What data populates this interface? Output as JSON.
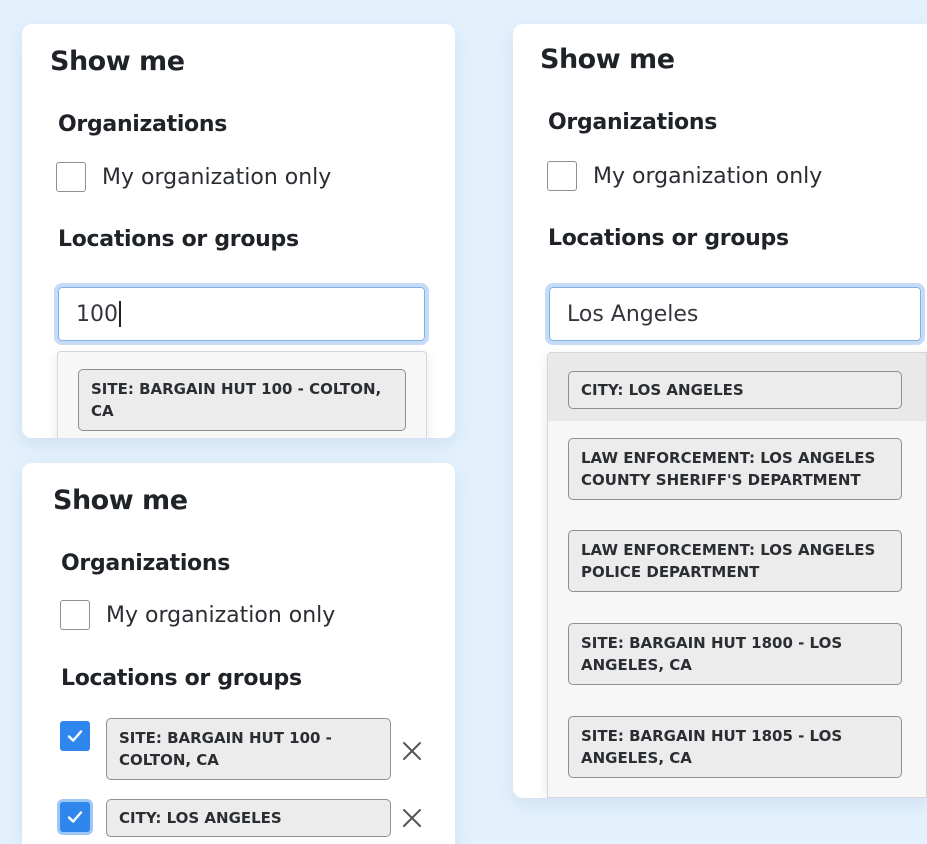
{
  "panels": {
    "p1": {
      "title": "Show me",
      "organizations_heading": "Organizations",
      "my_org_label": "My organization only",
      "locations_heading": "Locations or groups",
      "search_value": "100",
      "results": [
        "SITE: BARGAIN HUT 100 - COLTON, CA"
      ]
    },
    "p2": {
      "title": "Show me",
      "organizations_heading": "Organizations",
      "my_org_label": "My organization only",
      "locations_heading": "Locations or groups",
      "search_value": "Los Angeles",
      "results": [
        "CITY: LOS ANGELES",
        "LAW ENFORCEMENT: LOS ANGELES COUNTY SHERIFF'S DEPARTMENT",
        "LAW ENFORCEMENT: LOS ANGELES POLICE DEPARTMENT",
        "SITE: BARGAIN HUT 1800 - LOS ANGELES, CA",
        "SITE: BARGAIN HUT 1805 - LOS ANGELES, CA"
      ]
    },
    "p3": {
      "title": "Show me",
      "organizations_heading": "Organizations",
      "my_org_label": "My organization only",
      "locations_heading": "Locations or groups",
      "selected": [
        "SITE: BARGAIN HUT 100 - COLTON, CA",
        "CITY: LOS ANGELES"
      ]
    }
  },
  "icons": {
    "checkbox_checked": "checkmark-icon",
    "remove": "close-icon"
  },
  "colors": {
    "background": "#e3f1fd",
    "accent": "#2f87ed",
    "focus_ring": "#c6dcf6"
  }
}
